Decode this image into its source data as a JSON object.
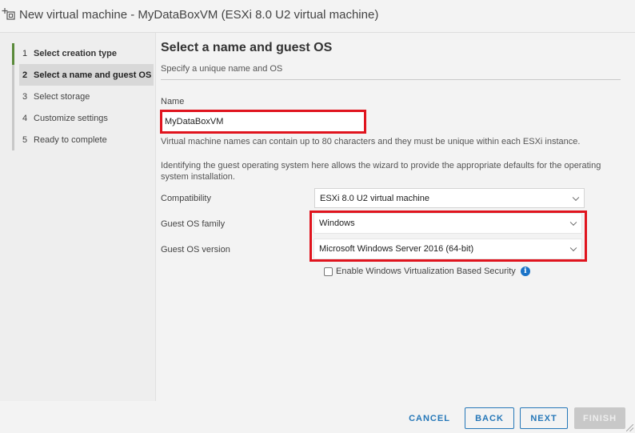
{
  "window": {
    "title": "New virtual machine - MyDataBoxVM (ESXi 8.0 U2 virtual machine)"
  },
  "steps": [
    {
      "num": "1",
      "label": "Select creation type",
      "state": "done"
    },
    {
      "num": "2",
      "label": "Select a name and guest OS",
      "state": "active"
    },
    {
      "num": "3",
      "label": "Select storage",
      "state": "pending"
    },
    {
      "num": "4",
      "label": "Customize settings",
      "state": "pending"
    },
    {
      "num": "5",
      "label": "Ready to complete",
      "state": "pending"
    }
  ],
  "page": {
    "title": "Select a name and guest OS",
    "subtitle": "Specify a unique name and OS"
  },
  "form": {
    "name_label": "Name",
    "name_value": "MyDataBoxVM",
    "name_hint": "Virtual machine names can contain up to 80 characters and they must be unique within each ESXi instance.",
    "guest_hint": "Identifying the guest operating system here allows the wizard to provide the appropriate defaults for the operating system installation.",
    "compatibility_label": "Compatibility",
    "compatibility_value": "ESXi 8.0 U2 virtual machine",
    "guest_family_label": "Guest OS family",
    "guest_family_value": "Windows",
    "guest_version_label": "Guest OS version",
    "guest_version_value": "Microsoft Windows Server 2016 (64-bit)",
    "vbs_label": "Enable Windows Virtualization Based Security",
    "vbs_checked": false
  },
  "footer": {
    "cancel_label": "CANCEL",
    "back_label": "BACK",
    "next_label": "NEXT",
    "finish_label": "FINISH"
  },
  "colors": {
    "highlight_red": "#e0141e",
    "accent_blue": "#2577b8",
    "step_done_green": "#5a8a3a"
  },
  "icons": {
    "title": "new-vm-icon",
    "info": "info-icon",
    "dropdown": "chevron-down-icon"
  }
}
